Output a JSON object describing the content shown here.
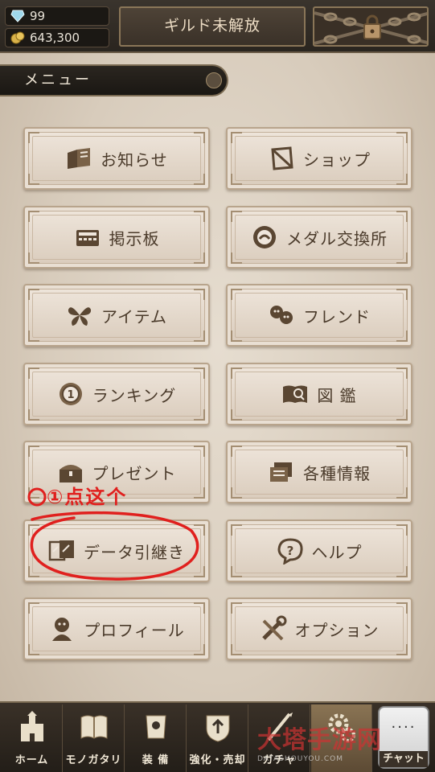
{
  "resources": {
    "gems": "99",
    "gold": "643,300"
  },
  "header": {
    "guild_label": "ギルド未解放"
  },
  "menu": {
    "title": "メニュー",
    "items": [
      {
        "label": "お知らせ",
        "icon": "news-flyer-icon"
      },
      {
        "label": "ショップ",
        "icon": "shop-crystal-icon"
      },
      {
        "label": "掲示板",
        "icon": "bulletin-board-icon"
      },
      {
        "label": "メダル交換所",
        "icon": "medal-exchange-icon"
      },
      {
        "label": "アイテム",
        "icon": "butterfly-icon"
      },
      {
        "label": "フレンド",
        "icon": "friends-faces-icon"
      },
      {
        "label": "ランキング",
        "icon": "ranking-medal-icon"
      },
      {
        "label": "図 鑑",
        "icon": "encyclopedia-book-icon"
      },
      {
        "label": "プレゼント",
        "icon": "present-chest-icon"
      },
      {
        "label": "各種情報",
        "icon": "info-cards-icon"
      },
      {
        "label": "データ引継き",
        "icon": "data-transfer-icon"
      },
      {
        "label": "ヘルプ",
        "icon": "help-question-icon"
      },
      {
        "label": "プロフィール",
        "icon": "profile-bust-icon"
      },
      {
        "label": "オプション",
        "icon": "options-tools-icon"
      }
    ]
  },
  "annotation": {
    "text": "①点这个",
    "color": "#e0201e"
  },
  "bottom_nav": {
    "items": [
      {
        "label": "ホーム",
        "icon": "castle-icon"
      },
      {
        "label": "モノガタリ",
        "icon": "story-book-icon"
      },
      {
        "label": "装 備",
        "icon": "equipment-armor-icon"
      },
      {
        "label": "強化・売却",
        "icon": "upgrade-sell-icon"
      },
      {
        "label": "ガチャ",
        "icon": "gacha-icon"
      },
      {
        "label": "",
        "icon": "menu-gears-icon"
      }
    ],
    "chat_label": "チャット",
    "chat_dots": "····"
  },
  "watermark": {
    "text": "大塔手游网",
    "sub": "DATASHOUYOU.COM"
  }
}
